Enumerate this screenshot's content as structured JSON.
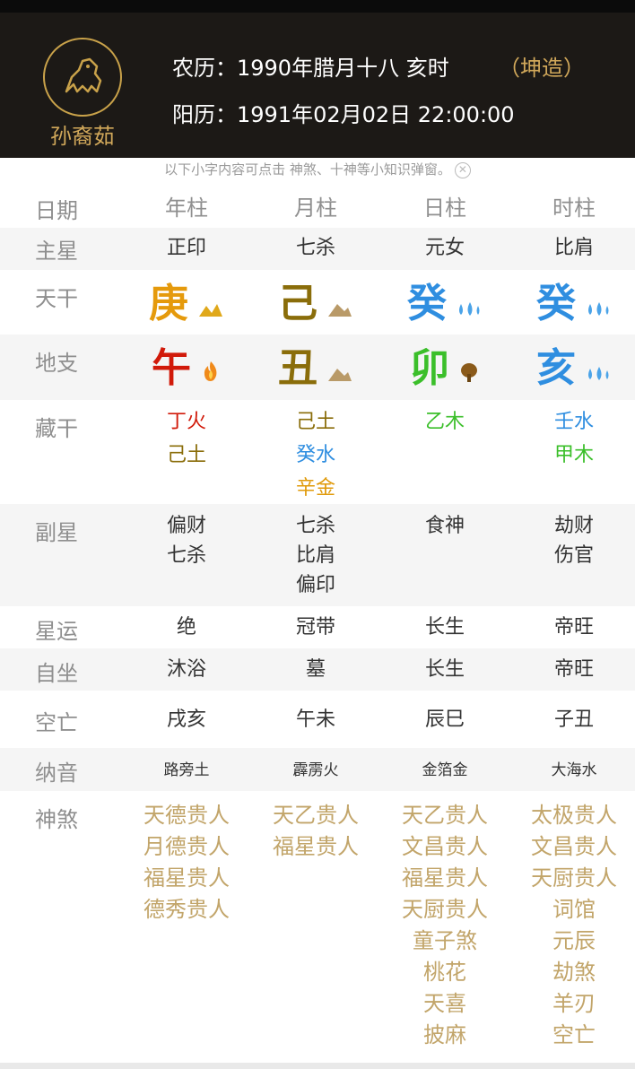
{
  "header": {
    "name": "孙裔茹",
    "lunar": "农历：1990年腊月十八 亥时",
    "gender": "（坤造）",
    "solar": "阳历：1991年02月02日 22:00:00"
  },
  "notice": "以下小字内容可点击 神煞、十神等小知识弹窗。",
  "columns": {
    "label": "日期",
    "c1": "年柱",
    "c2": "月柱",
    "c3": "日柱",
    "c4": "时柱"
  },
  "zhuxing": {
    "label": "主星",
    "values": [
      "正印",
      "七杀",
      "元女",
      "比肩"
    ]
  },
  "tiangan": {
    "label": "天干",
    "values": [
      "庚",
      "己",
      "癸",
      "癸"
    ],
    "colors": [
      "#e59a0c",
      "#8a6d0a",
      "#2f8ee0",
      "#2f8ee0"
    ],
    "icons": [
      "gold-icon",
      "earth-icon",
      "water-icon",
      "water-icon"
    ]
  },
  "dizhi": {
    "label": "地支",
    "values": [
      "午",
      "丑",
      "卯",
      "亥"
    ],
    "colors": [
      "#d11a0a",
      "#8a6d0a",
      "#3bbf2a",
      "#2f8ee0"
    ],
    "icons": [
      "fire-icon",
      "earth-icon",
      "wood-icon",
      "water-icon"
    ]
  },
  "canggan": {
    "label": "藏干",
    "col1": [
      "丁火",
      "己土"
    ],
    "col2": [
      "己土",
      "癸水",
      "辛金"
    ],
    "col3": [
      "乙木"
    ],
    "col4": [
      "壬水",
      "甲木"
    ]
  },
  "fuxing": {
    "label": "副星",
    "col1": [
      "偏财",
      "七杀"
    ],
    "col2": [
      "七杀",
      "比肩",
      "偏印"
    ],
    "col3": [
      "食神"
    ],
    "col4": [
      "劫财",
      "伤官"
    ]
  },
  "xingyun": {
    "label": "星运",
    "values": [
      "绝",
      "冠带",
      "长生",
      "帝旺"
    ]
  },
  "zizuo": {
    "label": "自坐",
    "values": [
      "沐浴",
      "墓",
      "长生",
      "帝旺"
    ]
  },
  "kongwang": {
    "label": "空亡",
    "values": [
      "戌亥",
      "午未",
      "辰巳",
      "子丑"
    ]
  },
  "nayin": {
    "label": "纳音",
    "values": [
      "路旁土",
      "霹雳火",
      "金箔金",
      "大海水"
    ]
  },
  "shensha": {
    "label": "神煞",
    "col1": [
      "天德贵人",
      "月德贵人",
      "福星贵人",
      "德秀贵人"
    ],
    "col2": [
      "天乙贵人",
      "福星贵人"
    ],
    "col3": [
      "天乙贵人",
      "文昌贵人",
      "福星贵人",
      "天厨贵人",
      "童子煞",
      "桃花",
      "天喜",
      "披麻"
    ],
    "col4": [
      "太极贵人",
      "文昌贵人",
      "天厨贵人",
      "词馆",
      "元辰",
      "劫煞",
      "羊刃",
      "空亡"
    ]
  }
}
